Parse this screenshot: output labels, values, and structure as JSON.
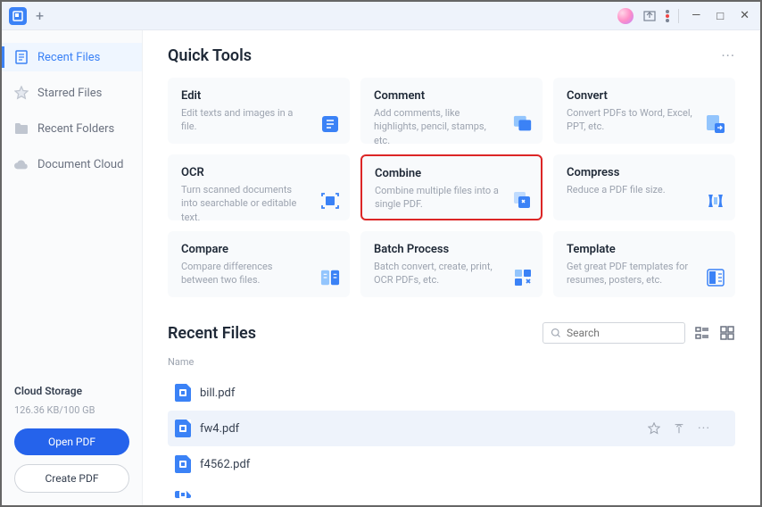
{
  "titlebar": {
    "plus": "+"
  },
  "sidebar": {
    "items": [
      {
        "label": "Recent Files"
      },
      {
        "label": "Starred Files"
      },
      {
        "label": "Recent Folders"
      },
      {
        "label": "Document Cloud"
      }
    ]
  },
  "cloud": {
    "title": "Cloud Storage",
    "usage": "126.36 KB/100 GB",
    "open_label": "Open PDF",
    "create_label": "Create PDF"
  },
  "quick_tools": {
    "title": "Quick Tools",
    "more": "···",
    "cards": [
      {
        "title": "Edit",
        "desc": "Edit texts and images in a file."
      },
      {
        "title": "Comment",
        "desc": "Add comments, like highlights, pencil, stamps, etc."
      },
      {
        "title": "Convert",
        "desc": "Convert PDFs to Word, Excel, PPT, etc."
      },
      {
        "title": "OCR",
        "desc": "Turn scanned documents into searchable or editable text."
      },
      {
        "title": "Combine",
        "desc": "Combine multiple files into a single PDF."
      },
      {
        "title": "Compress",
        "desc": "Reduce a PDF file size."
      },
      {
        "title": "Compare",
        "desc": "Compare differences between two files."
      },
      {
        "title": "Batch Process",
        "desc": "Batch convert, create, print, OCR PDFs, etc."
      },
      {
        "title": "Template",
        "desc": "Get great PDF templates for resumes, posters, etc."
      }
    ]
  },
  "recent": {
    "title": "Recent Files",
    "search_placeholder": "Search",
    "col_name": "Name",
    "files": [
      {
        "name": "bill.pdf"
      },
      {
        "name": "fw4.pdf"
      },
      {
        "name": "f4562.pdf"
      }
    ]
  }
}
